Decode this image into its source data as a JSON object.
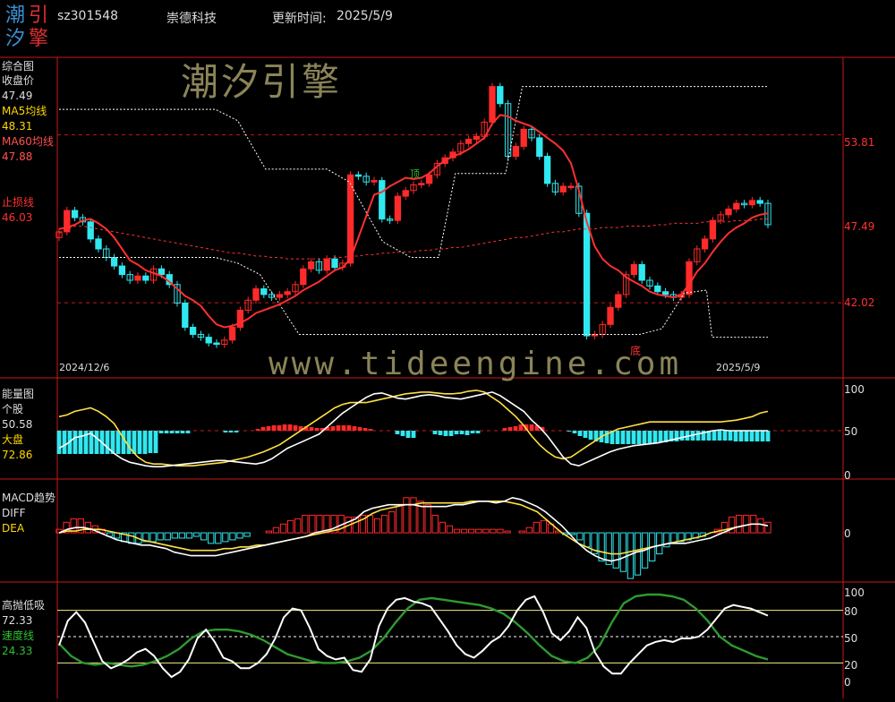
{
  "header": {
    "logo_chars": [
      "潮",
      "引",
      "汐",
      "擎"
    ],
    "code": "sz301548",
    "name": "崇德科技",
    "update_label": "更新时间:",
    "update_date": "2025/5/9"
  },
  "watermark": {
    "text1": "潮汐引擎",
    "text2": "www.tideengine.com"
  },
  "panel_main": {
    "title": "综合图",
    "close_label": "收盘价",
    "close_value": "47.49",
    "ma5_label": "MA5均线",
    "ma5_value": "48.31",
    "ma60_label": "MA60均线",
    "ma60_value": "47.88",
    "stop_label": "止损线",
    "stop_value": "46.03",
    "y_ticks": [
      "53.81",
      "47.49",
      "42.02"
    ],
    "date_start": "2024/12/6",
    "date_end": "2025/5/9",
    "bottom_mark": "底",
    "top_mark": "顶"
  },
  "panel_energy": {
    "title": "能量图",
    "stock_label": "个股",
    "stock_value": "50.58",
    "market_label": "大盘",
    "market_value": "72.86",
    "y_ticks": [
      "100",
      "50",
      "0"
    ]
  },
  "panel_macd": {
    "title": "MACD趋势",
    "diff_label": "DIFF",
    "dea_label": "DEA",
    "y_ticks": [
      "0"
    ]
  },
  "panel_hl": {
    "title": "高抛低吸",
    "value1": "72.33",
    "speed_label": "速度线",
    "speed_value": "24.33",
    "y_ticks": [
      "100",
      "80",
      "50",
      "20",
      "0"
    ]
  },
  "colors": {
    "up": "#ff2a2a",
    "down": "#30e8f0",
    "ma5": "#ff3030",
    "ma60": "#ff3030",
    "band": "#ffffff",
    "yellow": "#ffe040",
    "green": "#2f9a2f",
    "frame": "#c81818",
    "label_yellow": "#ffd700"
  },
  "chart_data": [
    {
      "type": "candlestick",
      "title": "综合图",
      "date_range": [
        "2024/12/6",
        "2025/5/9"
      ],
      "ylim": [
        37,
        59
      ],
      "y_ticks": [
        53.81,
        47.49,
        42.02
      ],
      "close": [
        47.0,
        48.5,
        48.0,
        47.7,
        46.5,
        45.8,
        45.2,
        44.6,
        44.0,
        43.6,
        43.9,
        43.6,
        44.4,
        44.0,
        43.3,
        42.0,
        40.3,
        39.8,
        39.6,
        39.2,
        39.1,
        39.4,
        40.3,
        41.5,
        42.2,
        43.0,
        42.6,
        42.4,
        42.6,
        42.8,
        43.3,
        44.4,
        44.9,
        44.3,
        45.1,
        44.5,
        44.8,
        51.0,
        50.9,
        50.5,
        50.6,
        47.9,
        47.8,
        49.5,
        49.9,
        50.3,
        50.4,
        51.0,
        51.8,
        52.2,
        52.6,
        53.2,
        53.5,
        53.7,
        54.7,
        57.2,
        56.0,
        52.3,
        53.0,
        54.2,
        53.6,
        52.3,
        50.4,
        49.8,
        50.2,
        50.2,
        48.3,
        39.7,
        39.8,
        40.5,
        41.7,
        42.6,
        44.0,
        44.7,
        43.6,
        43.2,
        42.8,
        42.6,
        42.4,
        42.6,
        44.9,
        45.8,
        46.5,
        47.8,
        48.2,
        48.6,
        49.0,
        48.9,
        49.2,
        49.0,
        47.5
      ],
      "ma5": [
        47.2,
        47.3,
        47.5,
        47.8,
        47.9,
        47.6,
        47.2,
        46.6,
        45.8,
        45.0,
        44.7,
        44.3,
        44.1,
        43.9,
        43.5,
        43.0,
        42.5,
        42.2,
        41.8,
        41.1,
        40.5,
        40.3,
        40.4,
        40.6,
        40.9,
        41.3,
        41.5,
        41.7,
        41.9,
        42.2,
        42.5,
        42.9,
        43.2,
        43.5,
        43.9,
        44.3,
        44.5,
        45.1,
        46.6,
        48.1,
        49.6,
        49.8,
        50.2,
        50.5,
        50.8,
        50.7,
        50.8,
        51.1,
        51.6,
        52.0,
        52.3,
        52.5,
        52.8,
        53.2,
        53.6,
        54.6,
        55.2,
        55.1,
        54.8,
        54.6,
        54.4,
        54.0,
        53.6,
        53.2,
        52.7,
        51.8,
        49.9,
        47.7,
        46.0,
        45.1,
        44.6,
        44.3,
        43.8,
        43.5,
        43.2,
        42.8,
        42.6,
        42.5,
        42.4,
        42.6,
        43.3,
        44.2,
        44.8,
        45.6,
        46.3,
        46.9,
        47.3,
        47.6,
        48.0,
        48.2,
        48.3
      ],
      "ma60": [
        46.9,
        47.2,
        47.4,
        47.4,
        47.3,
        47.2,
        47.1,
        47.0,
        46.9,
        46.8,
        46.7,
        46.6,
        46.5,
        46.4,
        46.3,
        46.2,
        46.1,
        46.0,
        45.9,
        45.8,
        45.7,
        45.6,
        45.5,
        45.5,
        45.4,
        45.3,
        45.3,
        45.2,
        45.2,
        45.1,
        45.1,
        45.1,
        45.1,
        45.1,
        45.1,
        45.2,
        45.2,
        45.3,
        45.3,
        45.4,
        45.4,
        45.5,
        45.5,
        45.6,
        45.6,
        45.6,
        45.7,
        45.7,
        45.8,
        45.8,
        45.9,
        45.9,
        46.0,
        46.1,
        46.2,
        46.3,
        46.4,
        46.5,
        46.6,
        46.6,
        46.7,
        46.8,
        46.9,
        47.0,
        47.0,
        47.1,
        47.2,
        47.2,
        47.2,
        47.3,
        47.3,
        47.3,
        47.4,
        47.4,
        47.4,
        47.4,
        47.5,
        47.5,
        47.6,
        47.6,
        47.6,
        47.6,
        47.7,
        47.7,
        47.7,
        47.7,
        47.8,
        47.8,
        47.8,
        47.9,
        47.9
      ],
      "band_upper": [
        {
          "i": 0,
          "v": 55.6
        },
        {
          "i": 28,
          "v": 55.6
        },
        {
          "i": 32,
          "v": 54.8
        },
        {
          "i": 37,
          "v": 51.4
        },
        {
          "i": 48,
          "v": 51.4
        },
        {
          "i": 52,
          "v": 50.5
        },
        {
          "i": 58,
          "v": 46.3
        },
        {
          "i": 63,
          "v": 45.2
        },
        {
          "i": 68,
          "v": 45.2
        },
        {
          "i": 71,
          "v": 51.1
        },
        {
          "i": 80,
          "v": 51.1
        },
        {
          "i": 83,
          "v": 57.2
        },
        {
          "i": 127,
          "v": 57.2
        }
      ],
      "band_lower": [
        {
          "i": 0,
          "v": 45.2
        },
        {
          "i": 28,
          "v": 45.2
        },
        {
          "i": 32,
          "v": 44.8
        },
        {
          "i": 36,
          "v": 44.0
        },
        {
          "i": 43,
          "v": 39.8
        },
        {
          "i": 104,
          "v": 39.8
        },
        {
          "i": 108,
          "v": 40.2
        },
        {
          "i": 112,
          "v": 42.7
        },
        {
          "i": 116,
          "v": 42.9
        },
        {
          "i": 117,
          "v": 39.6
        },
        {
          "i": 127,
          "v": 39.6
        }
      ],
      "dashed_red_levels": [
        53.81,
        42.02
      ]
    },
    {
      "type": "line",
      "title": "能量图",
      "ylim": [
        0,
        100
      ],
      "y_ticks": [
        100,
        50,
        0
      ],
      "series": [
        {
          "name": "个股",
          "values": [
            30,
            35,
            42,
            44,
            47,
            40,
            32,
            24,
            18,
            14,
            12,
            10,
            9,
            9,
            10,
            11,
            12,
            13,
            14,
            15,
            16,
            16,
            15,
            14,
            13,
            12,
            14,
            18,
            24,
            30,
            34,
            38,
            42,
            46,
            54,
            62,
            70,
            76,
            82,
            88,
            92,
            93,
            90,
            87,
            86,
            88,
            90,
            91,
            90,
            88,
            87,
            86,
            88,
            90,
            92,
            94,
            90,
            84,
            78,
            72,
            62,
            54,
            44,
            32,
            20,
            12,
            10,
            14,
            18,
            22,
            26,
            29,
            31,
            33,
            34,
            35,
            36,
            38,
            40,
            42,
            44,
            46,
            48,
            50,
            51,
            50,
            50,
            50,
            50,
            50,
            50
          ]
        },
        {
          "name": "大盘",
          "values": [
            66,
            68,
            72,
            74,
            76,
            72,
            66,
            58,
            44,
            30,
            20,
            14,
            12,
            12,
            11,
            10,
            10,
            10,
            11,
            12,
            13,
            14,
            16,
            18,
            20,
            23,
            26,
            30,
            34,
            40,
            46,
            52,
            58,
            64,
            70,
            76,
            80,
            82,
            82,
            82,
            84,
            86,
            88,
            90,
            92,
            93,
            94,
            94,
            93,
            92,
            92,
            93,
            95,
            96,
            94,
            88,
            82,
            74,
            66,
            56,
            44,
            34,
            26,
            20,
            18,
            20,
            26,
            32,
            38,
            44,
            48,
            52,
            54,
            56,
            58,
            60,
            60,
            60,
            60,
            60,
            60,
            60,
            60,
            60,
            60,
            61,
            62,
            64,
            66,
            70,
            72
          ]
        }
      ],
      "histogram": [
        -26,
        -26,
        -26,
        -26,
        -26,
        -26,
        -26,
        -26,
        -26,
        -26,
        -26,
        -26,
        -26,
        -26,
        -26,
        -26,
        -26,
        -25,
        -25,
        -3,
        -3,
        -3,
        -3,
        -3,
        -3,
        0,
        0,
        0,
        0,
        0,
        0,
        -2,
        -2,
        -2,
        0,
        0,
        0,
        2,
        4,
        5,
        6,
        6,
        7,
        7,
        6,
        5,
        5,
        4,
        3,
        3,
        4,
        5,
        6,
        6,
        6,
        5,
        4,
        3,
        2,
        0,
        0,
        0,
        0,
        -4,
        -6,
        -8,
        -8,
        0,
        0,
        0,
        -4,
        -5,
        -6,
        -6,
        -4,
        -4,
        -5,
        -3,
        -3,
        0,
        0,
        0,
        0,
        3,
        4,
        5,
        7,
        7,
        7,
        6,
        4,
        0,
        0,
        0,
        0,
        -1,
        -3,
        -6,
        -8,
        -10,
        -12,
        -13,
        -14,
        -15,
        -15,
        -15,
        -15,
        -15,
        -15,
        -15,
        -14,
        -14,
        -13,
        -13,
        -12,
        -12,
        -11,
        -11,
        -11,
        -11,
        -11,
        -11,
        -11,
        -11,
        -11,
        -11,
        -12,
        -12,
        -12,
        -12,
        -12,
        -12,
        -12
      ]
    },
    {
      "type": "line",
      "title": "MACD趋势",
      "ylim": [
        -2.8,
        2.4
      ],
      "y_ticks": [
        0
      ],
      "series": [
        {
          "name": "DIFF",
          "values": [
            0.0,
            0.2,
            0.3,
            0.3,
            0.2,
            0.0,
            -0.2,
            -0.4,
            -0.5,
            -0.6,
            -0.7,
            -0.7,
            -0.8,
            -0.9,
            -1.1,
            -1.2,
            -1.3,
            -1.3,
            -1.3,
            -1.3,
            -1.2,
            -1.1,
            -1.0,
            -0.9,
            -0.8,
            -0.7,
            -0.6,
            -0.5,
            -0.4,
            -0.3,
            -0.2,
            0.0,
            0.1,
            0.2,
            0.4,
            0.6,
            0.8,
            1.2,
            1.4,
            1.5,
            1.6,
            1.6,
            1.6,
            1.6,
            1.5,
            1.5,
            1.5,
            1.5,
            1.6,
            1.6,
            1.7,
            1.8,
            1.8,
            1.7,
            1.8,
            2.0,
            1.9,
            1.7,
            1.5,
            1.2,
            0.8,
            0.4,
            -0.1,
            -0.6,
            -1.0,
            -1.3,
            -1.5,
            -1.6,
            -1.5,
            -1.3,
            -1.1,
            -1.0,
            -0.8,
            -0.7,
            -0.6,
            -0.6,
            -0.6,
            -0.5,
            -0.4,
            -0.3,
            -0.1,
            0.1,
            0.3,
            0.4,
            0.5,
            0.5,
            0.4
          ]
        },
        {
          "name": "DEA",
          "values": [
            0.0,
            0.1,
            0.1,
            0.2,
            0.2,
            0.2,
            0.1,
            0.0,
            -0.1,
            -0.2,
            -0.4,
            -0.5,
            -0.6,
            -0.7,
            -0.8,
            -0.9,
            -1.0,
            -1.0,
            -1.0,
            -1.0,
            -0.9,
            -0.9,
            -0.8,
            -0.8,
            -0.7,
            -0.7,
            -0.6,
            -0.5,
            -0.4,
            -0.3,
            -0.2,
            -0.1,
            0.0,
            0.1,
            0.2,
            0.4,
            0.6,
            0.8,
            1.1,
            1.3,
            1.4,
            1.5,
            1.6,
            1.6,
            1.7,
            1.7,
            1.7,
            1.7,
            1.7,
            1.7,
            1.8,
            1.8,
            1.8,
            1.8,
            1.8,
            1.7,
            1.6,
            1.4,
            1.2,
            0.8,
            0.4,
            0.0,
            -0.3,
            -0.6,
            -0.8,
            -1.0,
            -1.1,
            -1.2,
            -1.2,
            -1.1,
            -1.0,
            -0.9,
            -0.8,
            -0.7,
            -0.6,
            -0.5,
            -0.4,
            -0.3,
            -0.2,
            0.0,
            0.1,
            0.2,
            0.3,
            0.4
          ]
        }
      ],
      "histogram": [
        0.2,
        0.6,
        0.8,
        0.8,
        0.6,
        0.4,
        0.2,
        -0.2,
        -0.3,
        -0.5,
        -0.6,
        -0.6,
        -0.5,
        -0.5,
        -0.4,
        -0.4,
        -0.3,
        -0.3,
        -0.3,
        -0.2,
        -0.4,
        -0.6,
        -0.6,
        -0.5,
        -0.4,
        -0.3,
        -0.2,
        0.0,
        0.0,
        0.1,
        0.3,
        0.5,
        0.7,
        0.8,
        1.0,
        1.0,
        1.0,
        1.0,
        1.0,
        1.0,
        0.9,
        0.9,
        1.0,
        1.0,
        0.8,
        1.0,
        1.2,
        1.6,
        2.0,
        2.0,
        1.8,
        1.6,
        1.0,
        0.6,
        0.4,
        0.2,
        0.2,
        0.2,
        0.2,
        0.2,
        0.2,
        0.2,
        0.1,
        0.0,
        0.1,
        0.3,
        0.6,
        0.7,
        0.5,
        0.1,
        -0.1,
        -0.1,
        -0.4,
        -0.8,
        -1.2,
        -1.6,
        -1.8,
        -2.0,
        -2.2,
        -2.6,
        -2.4,
        -2.0,
        -1.6,
        -1.2,
        -0.8,
        -0.6,
        -0.5,
        -0.4,
        -0.3,
        -0.2,
        0.0,
        0.2,
        0.6,
        0.9,
        1.0,
        1.0,
        1.0,
        0.8,
        0.6
      ]
    },
    {
      "type": "line",
      "title": "高抛低吸",
      "ylim": [
        0,
        100
      ],
      "y_ticks": [
        100,
        80,
        50,
        20,
        0
      ],
      "reference_lines": [
        80,
        50,
        20
      ],
      "series": [
        {
          "name": "高抛低吸",
          "values": [
            40,
            68,
            78,
            66,
            44,
            22,
            14,
            18,
            24,
            32,
            36,
            28,
            14,
            4,
            10,
            24,
            48,
            58,
            44,
            26,
            22,
            14,
            14,
            20,
            30,
            48,
            72,
            82,
            80,
            60,
            36,
            28,
            24,
            26,
            12,
            10,
            24,
            62,
            82,
            92,
            94,
            90,
            88,
            84,
            70,
            56,
            40,
            30,
            26,
            34,
            44,
            50,
            62,
            80,
            92,
            96,
            78,
            54,
            46,
            56,
            72,
            60,
            32,
            16,
            8,
            8,
            20,
            30,
            40,
            44,
            46,
            44,
            48,
            48,
            50,
            58,
            70,
            82,
            86,
            84,
            82,
            78,
            74
          ]
        },
        {
          "name": "速度线",
          "values": [
            42,
            28,
            20,
            18,
            20,
            18,
            16,
            18,
            22,
            28,
            36,
            48,
            56,
            58,
            58,
            56,
            52,
            46,
            38,
            30,
            26,
            22,
            20,
            20,
            22,
            26,
            34,
            48,
            66,
            82,
            92,
            94,
            92,
            90,
            88,
            86,
            82,
            76,
            66,
            54,
            40,
            28,
            22,
            20,
            26,
            40,
            66,
            88,
            96,
            98,
            98,
            96,
            92,
            82,
            68,
            50,
            40,
            34,
            28,
            24
          ]
        }
      ]
    }
  ]
}
